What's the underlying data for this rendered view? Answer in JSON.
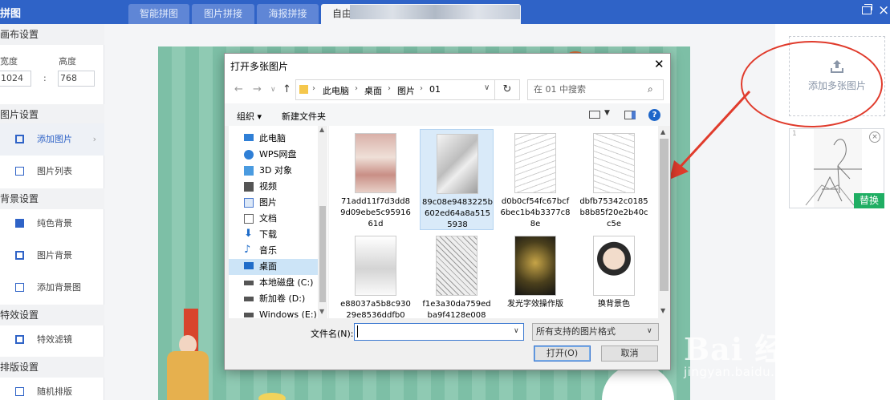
{
  "app": {
    "title": "拼图"
  },
  "tabs": [
    {
      "label": "智能拼图"
    },
    {
      "label": "图片拼接"
    },
    {
      "label": "海报拼接"
    },
    {
      "label": "自由"
    }
  ],
  "left": {
    "canvas_section": "画布设置",
    "width_label": "宽度",
    "height_label": "高度",
    "width_value": "1024",
    "colon": ":",
    "height_value": "768",
    "image_section": "图片设置",
    "add_image": "添加图片",
    "image_list": "图片列表",
    "bg_section": "背景设置",
    "solid_bg": "纯色背景",
    "image_bg": "图片背景",
    "add_bg": "添加背景图",
    "effect_section": "特效设置",
    "effect_filter": "特效滤镜",
    "layout_section": "排版设置",
    "random_layout": "随机排版"
  },
  "right": {
    "add_multi": "添加多张图片",
    "thumb_num": "1",
    "replace": "替换"
  },
  "dialog": {
    "title": "打开多张图片",
    "path": [
      "此电脑",
      "桌面",
      "图片",
      "01"
    ],
    "search_placeholder": "在 01 中搜索",
    "organize": "组织 ▾",
    "new_folder": "新建文件夹",
    "nav": [
      {
        "label": "此电脑",
        "icon": "computer-icon"
      },
      {
        "label": "WPS网盘",
        "icon": "cloud-icon"
      },
      {
        "label": "3D 对象",
        "icon": "cube-icon"
      },
      {
        "label": "视频",
        "icon": "video-icon"
      },
      {
        "label": "图片",
        "icon": "image-icon"
      },
      {
        "label": "文档",
        "icon": "document-icon"
      },
      {
        "label": "下载",
        "icon": "download-icon"
      },
      {
        "label": "音乐",
        "icon": "music-icon"
      },
      {
        "label": "桌面",
        "icon": "desktop-icon"
      },
      {
        "label": "本地磁盘 (C:)",
        "icon": "drive-icon"
      },
      {
        "label": "新加卷 (D:)",
        "icon": "drive-icon"
      },
      {
        "label": "Windows (E:)",
        "icon": "drive-icon"
      }
    ],
    "files": [
      {
        "name": "71add11f7d3dd89d09ebe5c9591661d"
      },
      {
        "name": "89c08e9483225b602ed64a8a5155938"
      },
      {
        "name": "d0b0cf54fc67bcf6bec1b4b3377c88e"
      },
      {
        "name": "dbfb75342c0185b8b85f20e2b40cc5e"
      },
      {
        "name": "e88037a5b8c93029e8536ddfb0"
      },
      {
        "name": "f1e3a30da759edba9f4128e008"
      },
      {
        "name": "发光字效操作版"
      },
      {
        "name": "换背景色"
      }
    ],
    "filename_label": "文件名(N):",
    "filename_value": "",
    "filetype": "所有支持的图片格式",
    "open_button": "打开(O)",
    "cancel_button": "取消"
  },
  "watermark": {
    "big": "Bai 经验",
    "small": "jingyan.baidu.com"
  },
  "colors": {
    "topbar": "#2f63c7",
    "accent": "#2f63c7",
    "replace": "#1fae63",
    "annotation": "#e03b2c"
  }
}
